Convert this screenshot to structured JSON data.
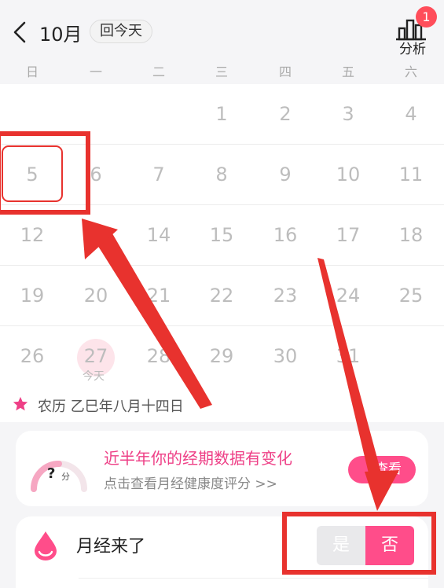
{
  "header": {
    "month": "10月",
    "today_button": "回今天",
    "analysis_label": "分析",
    "badge_count": "1"
  },
  "weekdays": [
    "日",
    "一",
    "二",
    "三",
    "四",
    "五",
    "六"
  ],
  "calendar": {
    "rows": [
      [
        "",
        "",
        "",
        "1",
        "2",
        "3",
        "4"
      ],
      [
        "5",
        "6",
        "7",
        "8",
        "9",
        "10",
        "11"
      ],
      [
        "12",
        "13",
        "14",
        "15",
        "16",
        "17",
        "18"
      ],
      [
        "19",
        "20",
        "21",
        "22",
        "23",
        "24",
        "25"
      ],
      [
        "26",
        "27",
        "28",
        "29",
        "30",
        "31",
        ""
      ]
    ],
    "today_label": "今天",
    "selected_day": "5",
    "today_day": "27"
  },
  "lunar": {
    "text": "农历 乙巳年八月十四日"
  },
  "health_card": {
    "score": "?",
    "score_unit": "分",
    "title": "近半年你的经期数据有变化",
    "subtitle": "点击查看月经健康度评分 >>",
    "view_button": "查看"
  },
  "period": {
    "label": "月经来了",
    "yes": "是",
    "no": "否"
  },
  "colors": {
    "accent": "#ff4d8a",
    "annotation": "#e8322e",
    "title_pink": "#ee3f86"
  }
}
